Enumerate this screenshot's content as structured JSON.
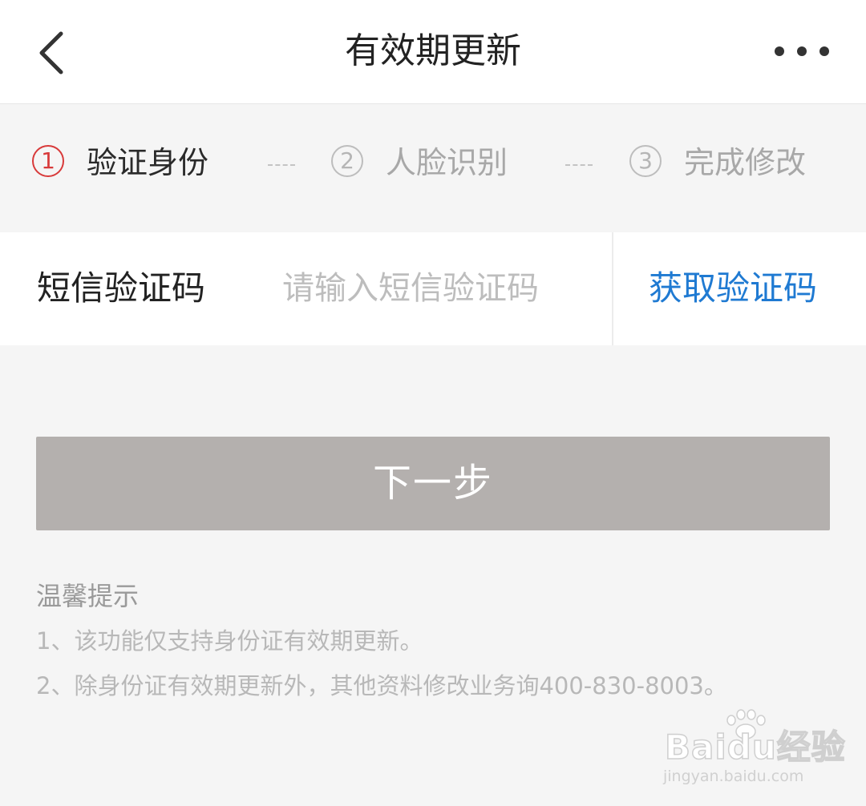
{
  "nav": {
    "title": "有效期更新",
    "back_icon": "chevron-left-icon",
    "more_icon": "more-horizontal-icon"
  },
  "steps": [
    {
      "number": "1",
      "label": "验证身份",
      "active": true
    },
    {
      "number": "2",
      "label": "人脸识别",
      "active": false
    },
    {
      "number": "3",
      "label": "完成修改",
      "active": false
    }
  ],
  "sms": {
    "label": "短信验证码",
    "value": "",
    "placeholder": "请输入短信验证码",
    "get_code_label": "获取验证码"
  },
  "next_button": {
    "label": "下一步"
  },
  "tips": {
    "title": "温馨提示",
    "lines": [
      "1、该功能仅支持身份证有效期更新。",
      "2、除身份证有效期更新外，其他资料修改业务询400-830-8003。"
    ]
  },
  "watermark": {
    "brand": "Baidu经验",
    "url": "jingyan.baidu.com"
  },
  "colors": {
    "active_step": "#d83a3a",
    "link": "#1f7ad2",
    "button_disabled": "#b4b0ae",
    "background": "#f5f5f5"
  }
}
